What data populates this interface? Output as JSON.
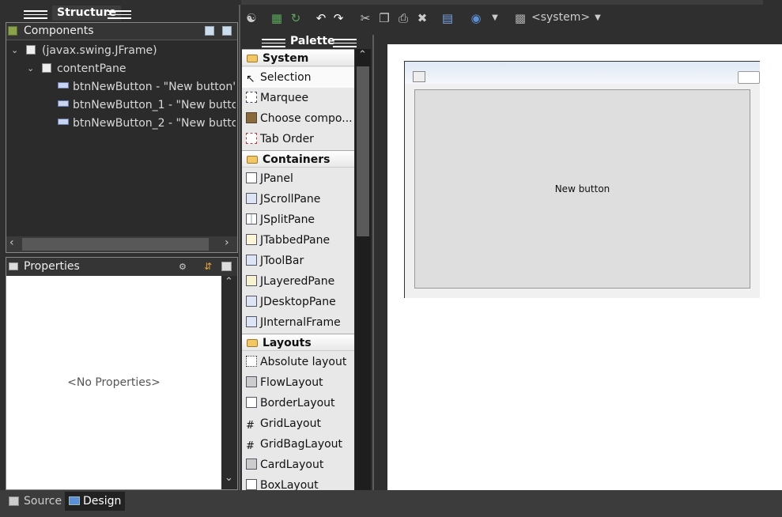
{
  "structure": {
    "title": "Structure"
  },
  "components": {
    "title": "Components",
    "tree": [
      {
        "label": "(javax.swing.JFrame)"
      },
      {
        "label": "contentPane"
      },
      {
        "label": "btnNewButton - \"New button\""
      },
      {
        "label": "btnNewButton_1 - \"New butto"
      },
      {
        "label": "btnNewButton_2 - \"New butto"
      }
    ]
  },
  "properties": {
    "title": "Properties",
    "empty_text": "<No Properties>"
  },
  "palette": {
    "title": "Palette",
    "system": {
      "label": "System",
      "items": [
        "Selection",
        "Marquee",
        "Choose compo...",
        "Tab Order"
      ]
    },
    "containers": {
      "label": "Containers",
      "items": [
        "JPanel",
        "JScrollPane",
        "JSplitPane",
        "JTabbedPane",
        "JToolBar",
        "JLayeredPane",
        "JDesktopPane",
        "JInternalFrame"
      ]
    },
    "layouts": {
      "label": "Layouts",
      "items": [
        "Absolute layout",
        "FlowLayout",
        "BorderLayout",
        "GridLayout",
        "GridBagLayout",
        "CardLayout",
        "BoxLayout"
      ]
    }
  },
  "toolbar": {
    "laf": "<system>"
  },
  "canvas": {
    "button_label": "New button"
  },
  "bottom_tabs": {
    "source": "Source",
    "design": "Design"
  }
}
